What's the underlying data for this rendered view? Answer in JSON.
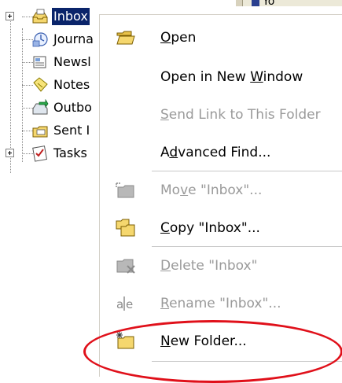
{
  "topstrip": {
    "text": "Yo"
  },
  "tree": {
    "nodes": [
      {
        "label": "Inbox",
        "icon": "inbox-icon",
        "expandable": true,
        "selected": true
      },
      {
        "label": "Journa",
        "icon": "journal-icon",
        "expandable": false
      },
      {
        "label": "Newsl",
        "icon": "newsletter-icon",
        "expandable": false
      },
      {
        "label": "Notes",
        "icon": "notes-icon",
        "expandable": false
      },
      {
        "label": "Outbo",
        "icon": "outbox-icon",
        "expandable": false
      },
      {
        "label": "Sent I",
        "icon": "sent-items-icon",
        "expandable": false
      },
      {
        "label": "Tasks",
        "icon": "tasks-icon",
        "expandable": true
      }
    ]
  },
  "menu": {
    "open": {
      "pre": "",
      "key": "O",
      "post": "pen",
      "enabled": true,
      "icon": "open-folder-icon"
    },
    "open_new_window": {
      "pre": "Open in New ",
      "key": "W",
      "post": "indow",
      "enabled": true
    },
    "send_link": {
      "pre": "",
      "key": "S",
      "post": "end Link to This Folder",
      "enabled": false
    },
    "advanced_find": {
      "pre": "A",
      "key": "d",
      "post": "vanced Find...",
      "enabled": true
    },
    "move": {
      "pre": "Mo",
      "key": "v",
      "post": "e \"Inbox\"...",
      "enabled": false,
      "icon": "move-folder-icon"
    },
    "copy": {
      "pre": "",
      "key": "C",
      "post": "opy \"Inbox\"...",
      "enabled": true,
      "icon": "copy-folder-icon"
    },
    "delete": {
      "pre": "",
      "key": "D",
      "post": "elete \"Inbox\"",
      "enabled": false,
      "icon": "delete-folder-icon"
    },
    "rename": {
      "pre": "",
      "key": "R",
      "post": "ename \"Inbox\"...",
      "enabled": false,
      "icon": "rename-icon",
      "icon_text": "a|e"
    },
    "new_folder": {
      "pre": "",
      "key": "N",
      "post": "ew Folder...",
      "enabled": true,
      "icon": "new-folder-icon"
    }
  },
  "colors": {
    "selection": "#0a246a",
    "disabled_text": "#9a9a9a",
    "highlight_ellipse": "#e0101a",
    "folder_yellow": "#f5d76e"
  }
}
